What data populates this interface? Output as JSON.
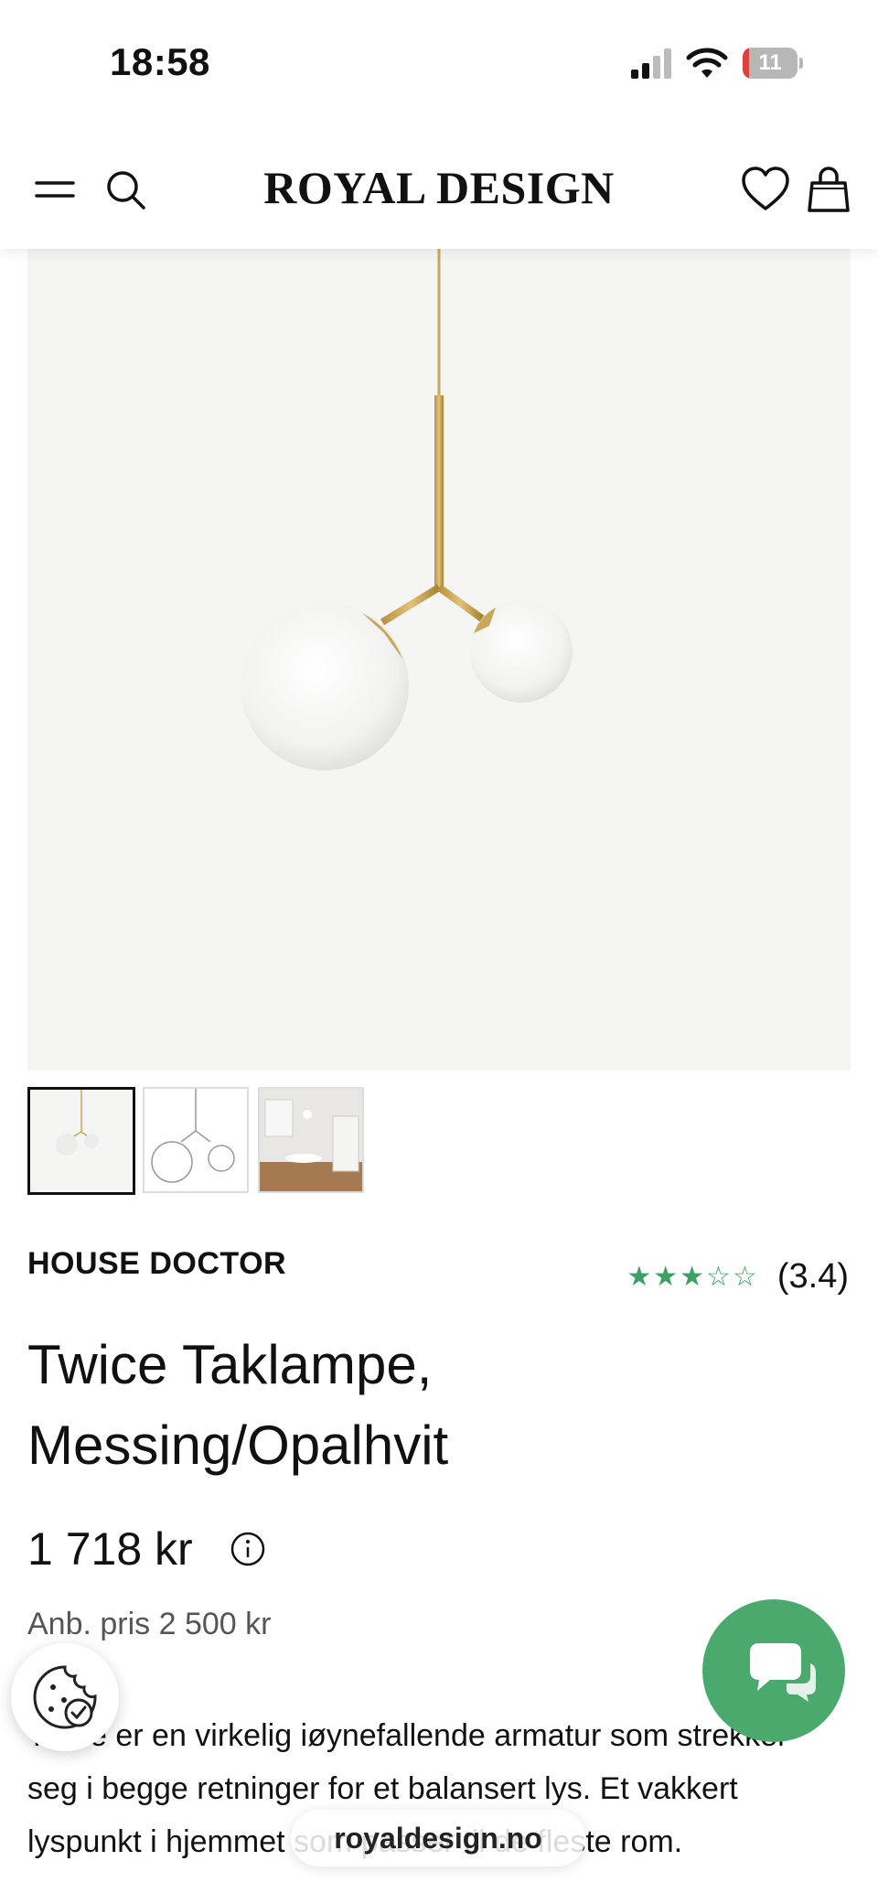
{
  "status_bar": {
    "time": "18:58",
    "battery_level": "11",
    "battery_fraction": 0.11
  },
  "header": {
    "logo": "ROYAL DESIGN"
  },
  "product": {
    "brand": "HOUSE DOCTOR",
    "rating_value": 3.4,
    "rating_max": 5,
    "rating_text": "(3.4)",
    "title": "Twice Taklampe, Messing/Opalhvit",
    "price": "1 718 kr",
    "recommended_price": "Anb. pris 2 500 kr",
    "description": "Twice er en virkelig iøynefallende armatur som strekker seg i begge retninger for et balansert lys. Et vakkert lyspunkt i hjemmet som passer til de fleste rom.",
    "thumbnails": [
      {
        "name": "thumb-lamp-photo",
        "active": true
      },
      {
        "name": "thumb-dimension-drawing",
        "active": false
      },
      {
        "name": "thumb-room-photo",
        "active": false
      }
    ]
  },
  "browser": {
    "url": "royaldesign.no"
  },
  "colors": {
    "accent_green": "#4aa96c",
    "star_green": "#3f9f64",
    "battery_red": "#e0403c"
  },
  "icons": [
    "menu-icon",
    "search-icon",
    "heart-icon",
    "bag-icon",
    "info-icon",
    "cookie-icon",
    "chat-icon"
  ]
}
